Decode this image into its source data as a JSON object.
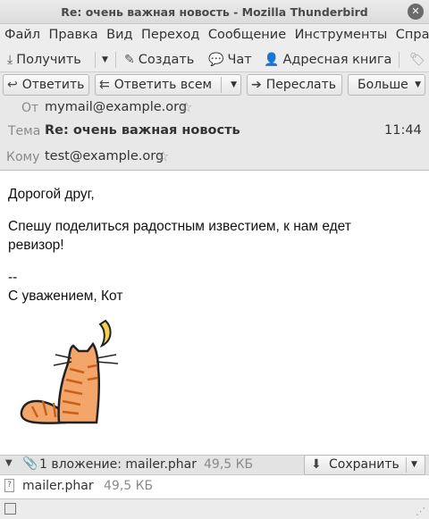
{
  "window": {
    "title": "Re: очень важная новость - Mozilla Thunderbird"
  },
  "menubar": {
    "items": [
      "Файл",
      "Правка",
      "Вид",
      "Переход",
      "Сообщение",
      "Инструменты",
      "Справ"
    ]
  },
  "toolbar": {
    "get_label": "Получить",
    "compose_label": "Создать",
    "chat_label": "Чат",
    "addressbook_label": "Адресная книга"
  },
  "actions": {
    "reply_label": "Ответить",
    "reply_all_label": "Ответить всем",
    "forward_label": "Переслать",
    "more_label": "Больше"
  },
  "header": {
    "from_label": "От",
    "from_value": "mymail@example.org",
    "subject_label": "Тема",
    "subject_value": "Re: очень важная новость",
    "time": "11:44",
    "to_label": "Кому",
    "to_value": "test@example.org"
  },
  "message": {
    "greeting": "Дорогой друг,",
    "line1": "Спешу поделиться радостным известием, к нам едет",
    "line2": "ревизор!",
    "sig_sep": "--",
    "signature": "С уважением, Кот"
  },
  "attachments": {
    "summary": "1 вложение: mailer.phar",
    "summary_size": "49,5 КБ",
    "save_label": "Сохранить",
    "items": [
      {
        "name": "mailer.phar",
        "size": "49,5 КБ"
      }
    ]
  },
  "colors": {
    "cat_orange": "#f4a56a",
    "cat_stripes": "#d2691e",
    "banana": "#f6d24a"
  }
}
